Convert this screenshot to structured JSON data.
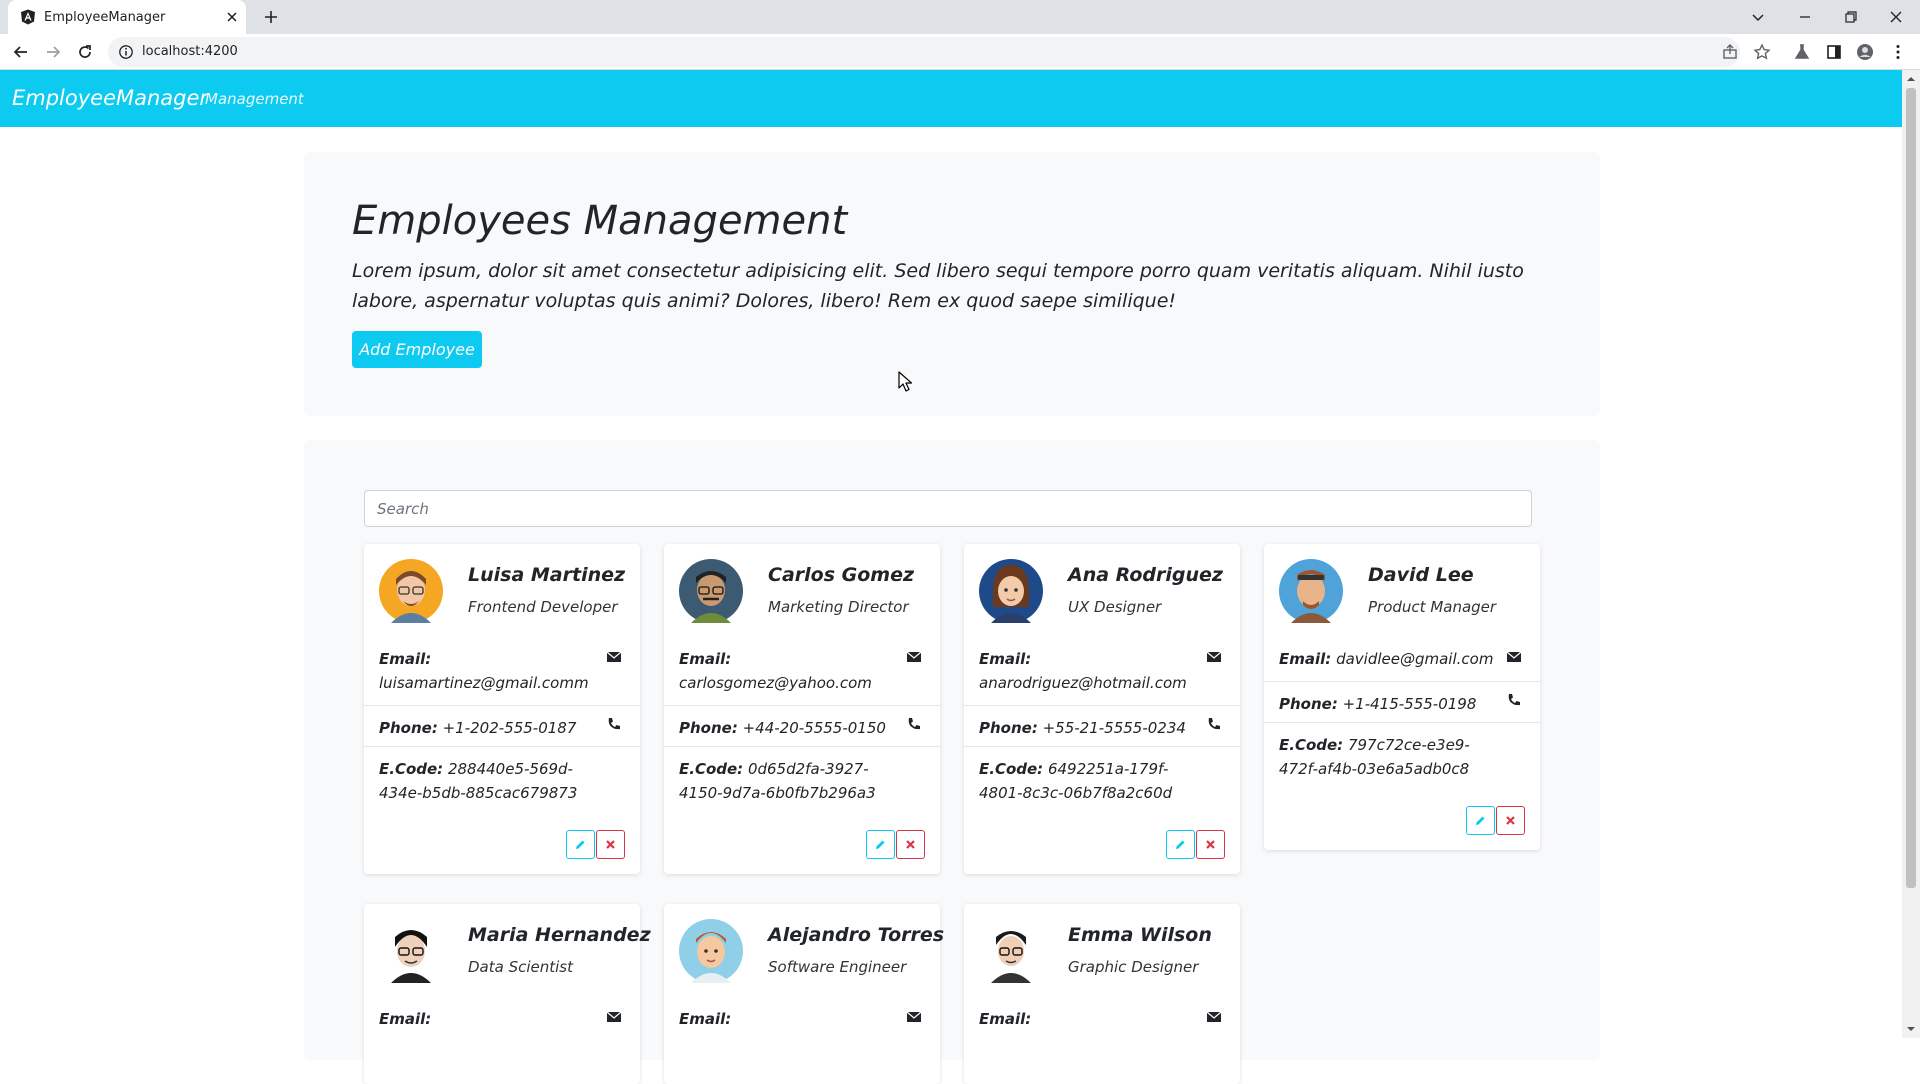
{
  "browser": {
    "tab_title": "EmployeeManager",
    "url": "localhost:4200"
  },
  "navbar": {
    "brand": "EmployeeManager",
    "link": "Management",
    "bg_color": "#0dcaf0"
  },
  "hero": {
    "title": "Employees Management",
    "description": "Lorem ipsum, dolor sit amet consectetur adipisicing elit. Sed libero sequi tempore porro quam veritatis aliquam. Nihil iusto labore, aspernatur voluptas quis animi? Dolores, libero! Rem ex quod saepe similique!",
    "add_button": "Add Employee"
  },
  "search": {
    "placeholder": "Search"
  },
  "labels": {
    "email": "Email:",
    "phone": "Phone:",
    "code": "E.Code:"
  },
  "employees": [
    {
      "name": "Luisa Martinez",
      "job": "Frontend Developer",
      "email": "luisamartinez@gmail.comm",
      "phone": "+1-202-555-0187",
      "code": "288440e5-569d-434e-b5db-885cac679873"
    },
    {
      "name": "Carlos Gomez",
      "job": "Marketing Director",
      "email": "carlosgomez@yahoo.com",
      "phone": "+44-20-5555-0150",
      "code": "0d65d2fa-3927-4150-9d7a-6b0fb7b296a3"
    },
    {
      "name": "Ana Rodriguez",
      "job": "UX Designer",
      "email": "anarodriguez@hotmail.com",
      "phone": "+55-21-5555-0234",
      "code": "6492251a-179f-4801-8c3c-06b7f8a2c60d"
    },
    {
      "name": "David Lee",
      "job": "Product Manager",
      "email": "davidlee@gmail.com",
      "phone": "+1-415-555-0198",
      "code": "797c72ce-e3e9-472f-af4b-03e6a5adb0c8"
    },
    {
      "name": "Maria Hernandez",
      "job": "Data Scientist"
    },
    {
      "name": "Alejandro Torres",
      "job": "Software Engineer"
    },
    {
      "name": "Emma Wilson",
      "job": "Graphic Designer"
    }
  ]
}
